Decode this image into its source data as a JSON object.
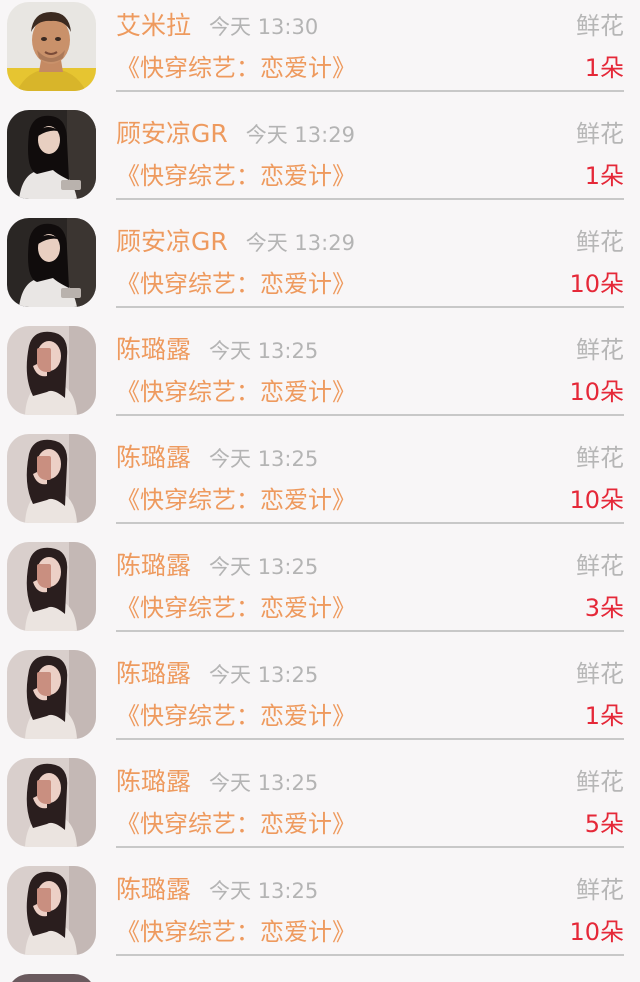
{
  "gifts": [
    {
      "user": "艾米拉",
      "time": "今天 13:30",
      "book": "《快穿综艺：恋爱计》",
      "gift": "鲜花",
      "count": "1朵",
      "avatar": "male-player-avatar"
    },
    {
      "user": "顾安凉GR",
      "time": "今天 13:29",
      "book": "《快穿综艺：恋爱计》",
      "gift": "鲜花",
      "count": "1朵",
      "avatar": "girl-dark-avatar"
    },
    {
      "user": "顾安凉GR",
      "time": "今天 13:29",
      "book": "《快穿综艺：恋爱计》",
      "gift": "鲜花",
      "count": "10朵",
      "avatar": "girl-dark-avatar"
    },
    {
      "user": "陈璐露",
      "time": "今天 13:25",
      "book": "《快穿综艺：恋爱计》",
      "gift": "鲜花",
      "count": "10朵",
      "avatar": "girl-phone-avatar"
    },
    {
      "user": "陈璐露",
      "time": "今天 13:25",
      "book": "《快穿综艺：恋爱计》",
      "gift": "鲜花",
      "count": "10朵",
      "avatar": "girl-phone-avatar"
    },
    {
      "user": "陈璐露",
      "time": "今天 13:25",
      "book": "《快穿综艺：恋爱计》",
      "gift": "鲜花",
      "count": "3朵",
      "avatar": "girl-phone-avatar"
    },
    {
      "user": "陈璐露",
      "time": "今天 13:25",
      "book": "《快穿综艺：恋爱计》",
      "gift": "鲜花",
      "count": "1朵",
      "avatar": "girl-phone-avatar"
    },
    {
      "user": "陈璐露",
      "time": "今天 13:25",
      "book": "《快穿综艺：恋爱计》",
      "gift": "鲜花",
      "count": "5朵",
      "avatar": "girl-phone-avatar"
    },
    {
      "user": "陈璐露",
      "time": "今天 13:25",
      "book": "《快穿综艺：恋爱计》",
      "gift": "鲜花",
      "count": "10朵",
      "avatar": "girl-phone-avatar"
    }
  ],
  "colors": {
    "background": "#f8f6f7",
    "accent_orange": "#ee9a5e",
    "count_red": "#e52838",
    "muted_gray": "#b4b4b4",
    "divider": "#c8c8c8"
  }
}
